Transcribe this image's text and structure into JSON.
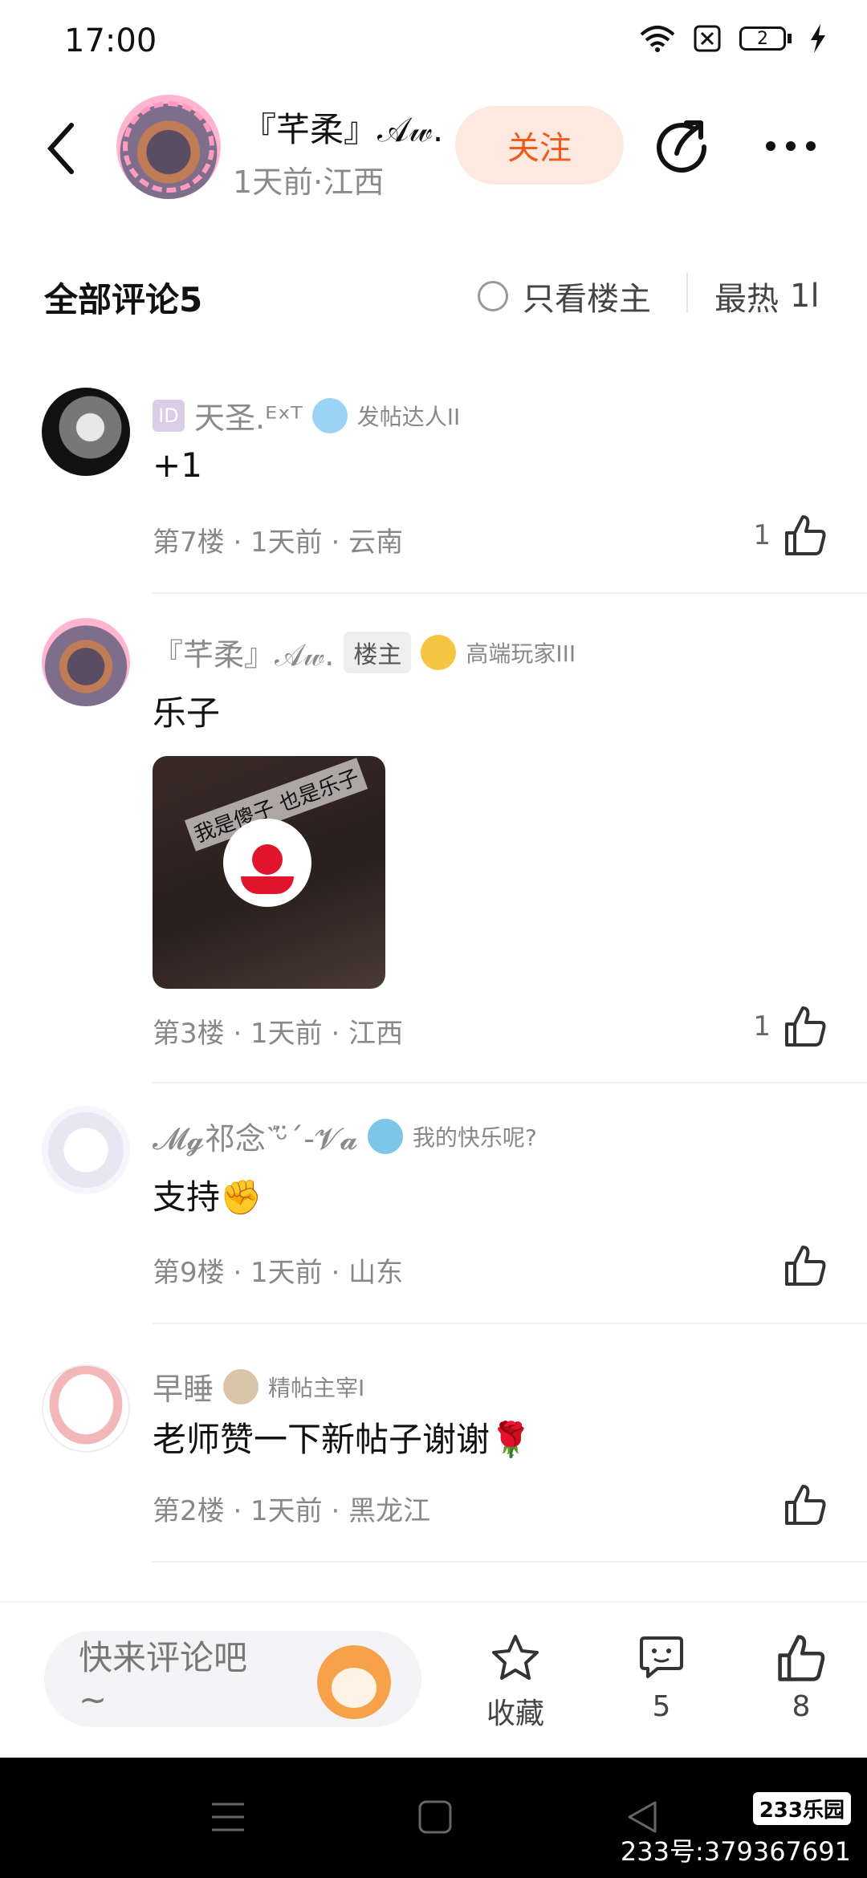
{
  "status": {
    "time": "17:00",
    "battery": "2"
  },
  "post_header": {
    "author_name": "『芊柔』𝒜𝓌.",
    "author_meta": "1天前·江西",
    "follow_label": "关注"
  },
  "comments_header": {
    "title": "全部评论5",
    "owner_only": "只看楼主",
    "sort": "最热",
    "sort_icon": "1l"
  },
  "comments": [
    {
      "id_tag": "ID",
      "name": "天圣.ᴱˣᵀ",
      "badge": "发帖达人II",
      "text": "+1",
      "meta": "第7楼 · 1天前 · 云南",
      "likes": "1"
    },
    {
      "name": "『芊柔』𝒜𝓌.",
      "owner_tag": "楼主",
      "badge": "高端玩家III",
      "text": "乐子",
      "image_text": "我是傻子  也是乐子",
      "meta": "第3楼 · 1天前 · 江西",
      "likes": "1"
    },
    {
      "name": "𝓜𝓰祁念ˋ͛ᵕ̈ˊ-𝓥𝓪",
      "badge": "我的快乐呢?",
      "text": "支持✊",
      "meta": "第9楼 · 1天前 · 山东",
      "likes": ""
    },
    {
      "name": "早睡",
      "badge": "精帖主宰I",
      "text": "老师赞一下新帖子谢谢🌹",
      "meta": "第2楼 · 1天前 · 黑龙江",
      "likes": ""
    }
  ],
  "bottom_bar": {
    "placeholder_line1": "快来评论吧",
    "placeholder_line2": "~",
    "favorite_label": "收藏",
    "comment_count": "5",
    "like_count": "8"
  },
  "watermark": {
    "logo": "233乐园",
    "id": "233号:379367691"
  },
  "colors": {
    "accent": "#f05a1a",
    "follow_bg": "#fde9e0"
  },
  "icons": [
    "back-icon",
    "share-icon",
    "more-icon",
    "thumbs-up-icon",
    "star-icon",
    "chat-icon",
    "wifi-icon",
    "battery-icon"
  ]
}
